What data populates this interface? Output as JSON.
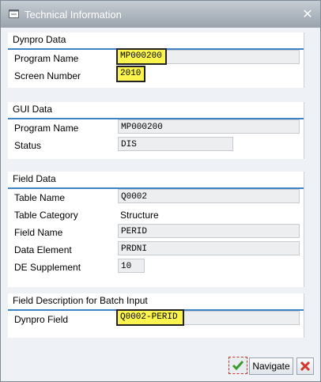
{
  "window": {
    "title": "Technical Information",
    "close_icon": "close-icon",
    "title_icon": "info-window-icon"
  },
  "dynpro": {
    "title": "Dynpro Data",
    "program_name_label": "Program Name",
    "program_name_value": "MP000200",
    "screen_number_label": "Screen Number",
    "screen_number_value": "2010"
  },
  "gui": {
    "title": "GUI Data",
    "program_name_label": "Program Name",
    "program_name_value": "MP000200",
    "status_label": "Status",
    "status_value": "DIS"
  },
  "field": {
    "title": "Field Data",
    "table_name_label": "Table Name",
    "table_name_value": "Q0002",
    "table_category_label": "Table Category",
    "table_category_value": "Structure",
    "field_name_label": "Field Name",
    "field_name_value": "PERID",
    "data_element_label": "Data Element",
    "data_element_value": "PRDNI",
    "de_supplement_label": "DE Supplement",
    "de_supplement_value": "10"
  },
  "batch": {
    "title": "Field Description for Batch Input",
    "dynpro_field_label": "Dynpro Field",
    "dynpro_field_value": "Q0002-PERID"
  },
  "footer": {
    "navigate_label": "Navigate"
  },
  "colors": {
    "highlight": "#fbf44e",
    "group_line": "#3e82c7",
    "cancel_red": "#d0392b",
    "ok_green": "#3a9a2a"
  }
}
